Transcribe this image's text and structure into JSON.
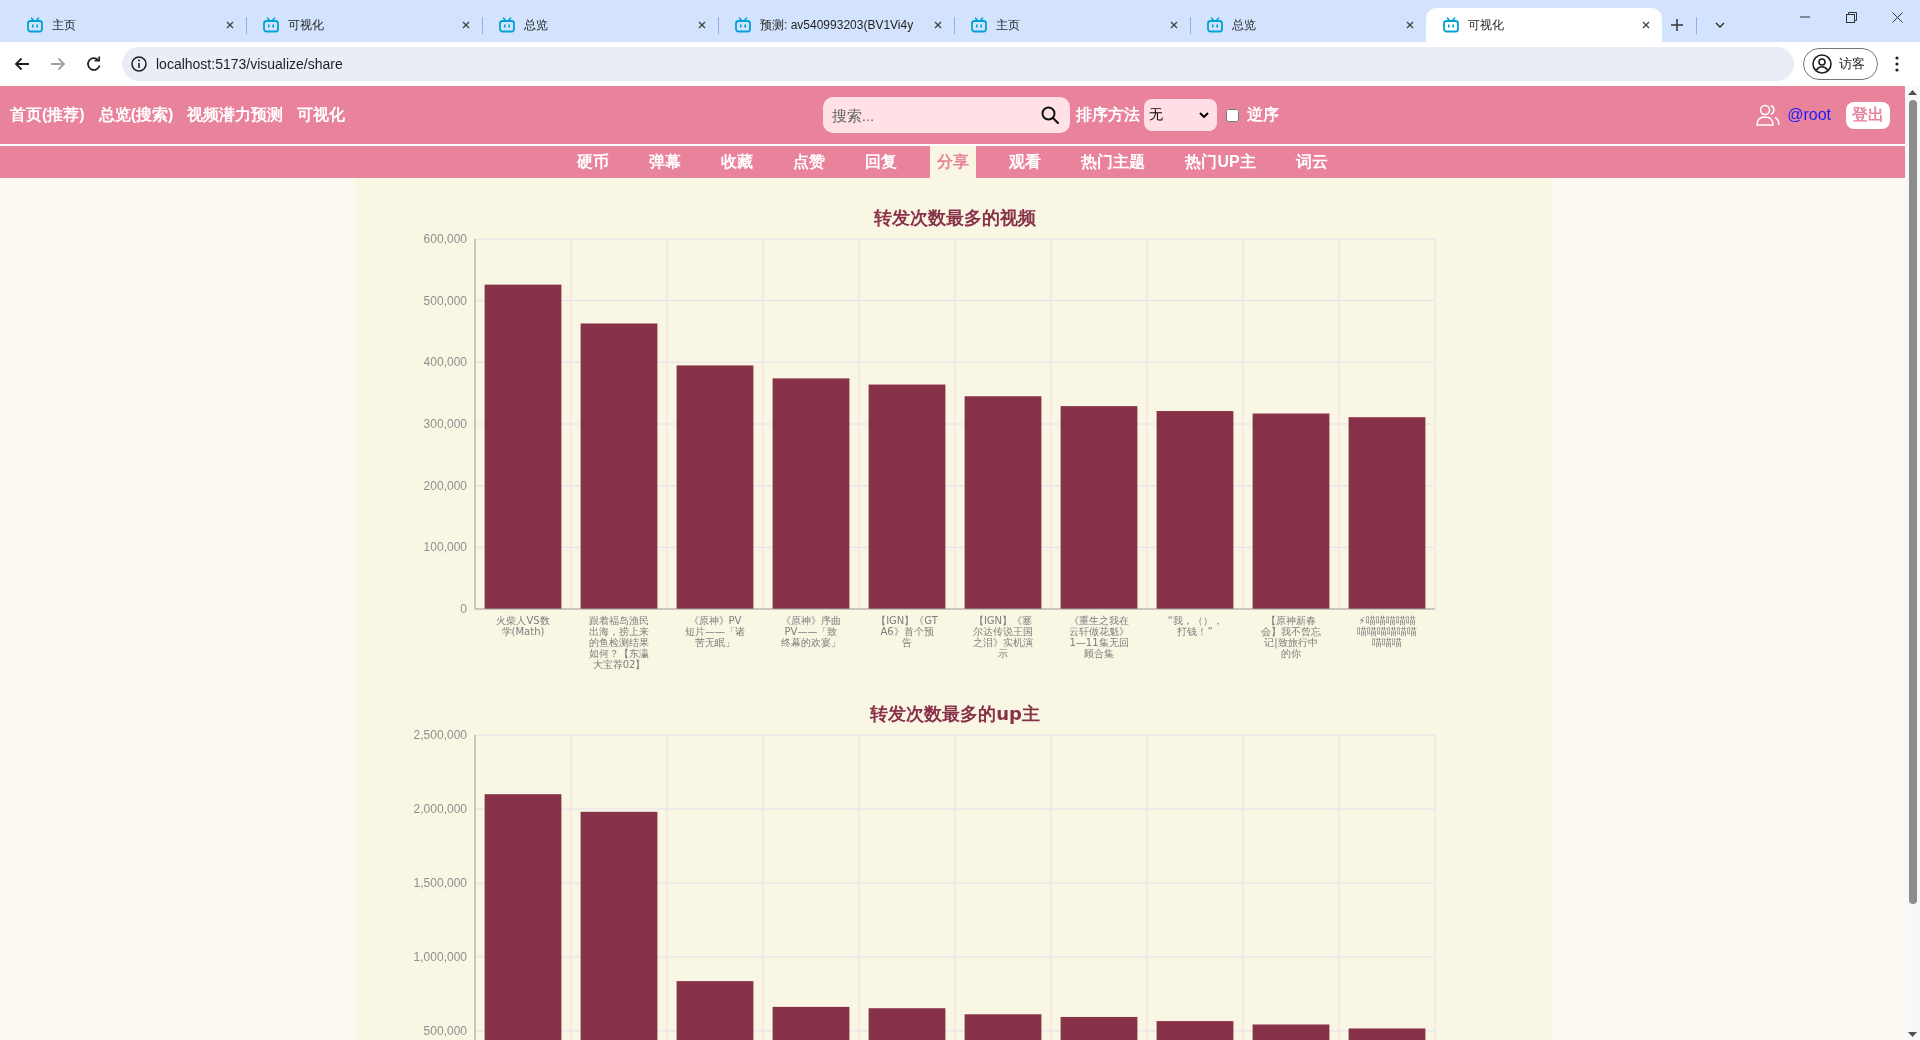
{
  "browser": {
    "tabs": [
      {
        "title": "主页",
        "selected": false
      },
      {
        "title": "可视化",
        "selected": false
      },
      {
        "title": "总览",
        "selected": false
      },
      {
        "title": "预测: av540993203(BV1Vi4y",
        "selected": false
      },
      {
        "title": "主页",
        "selected": false
      },
      {
        "title": "总览",
        "selected": false
      },
      {
        "title": "可视化",
        "selected": true
      }
    ],
    "url": "localhost:5173/visualize/share",
    "profile": "访客"
  },
  "header": {
    "nav": [
      "首页(推荐)",
      "总览(搜索)",
      "视频潜力预测",
      "可视化"
    ],
    "search": {
      "placeholder": "搜索..."
    },
    "sort": {
      "label": "排序方法",
      "value": "无"
    },
    "reverse": {
      "label": "逆序",
      "checked": false
    },
    "user": "@root",
    "logout": "登出"
  },
  "subnav": [
    {
      "label": "硬币",
      "selected": false
    },
    {
      "label": "弹幕",
      "selected": false
    },
    {
      "label": "收藏",
      "selected": false
    },
    {
      "label": "点赞",
      "selected": false
    },
    {
      "label": "回复",
      "selected": false
    },
    {
      "label": "分享",
      "selected": true
    },
    {
      "label": "观看",
      "selected": false
    },
    {
      "label": "热门主题",
      "selected": false
    },
    {
      "label": "热门UP主",
      "selected": false
    },
    {
      "label": "词云",
      "selected": false
    }
  ],
  "charts": [
    {
      "chart_data": {
        "type": "bar",
        "title": "转发次数最多的视频",
        "categories": [
          "火柴人VS数学(Math)",
          "跟着福岛渔民出海，捞上来的鱼检测结果如何？【东瀛大宝荐02】",
          "《原神》PV短片——「诸苦无眠」",
          "《原神》序曲PV——「致终幕的欢宴」",
          "【IGN】《GTA6》首个预告",
          "【IGN】《塞尔达传说王国之泪》实机演示",
          "《重生之我在云轩做花魁》1—11集无回顾合集",
          "“我，（），打钱！”",
          "【原神新春会】我不曾忘记|致旅行中的你",
          "⚡喵喵喵喵喵喵喵喵喵喵喵喵喵喵"
        ],
        "series": [
          {
            "color": "#883249",
            "values": [
              526000,
              463000,
              395000,
              374000,
              364000,
              345000,
              329000,
              321000,
              317000,
              311000
            ]
          }
        ],
        "ylim": [
          0,
          600000
        ],
        "yticks": [
          0,
          {
            "value": 100000,
            "label": "100,000"
          },
          {
            "value": 200000,
            "label": "200,000"
          },
          {
            "value": 300000,
            "label": "300,000"
          },
          {
            "value": 400000,
            "label": "400,000"
          },
          {
            "value": 500000,
            "label": "500,000"
          },
          {
            "value": 600000,
            "label": "600,000"
          }
        ],
        "grid": true
      }
    },
    {
      "chart_data": {
        "type": "bar",
        "title": "转发次数最多的up主",
        "series": [
          {
            "color": "#883249",
            "values": [
              2100000,
              1981000,
              837000,
              663000,
              654000,
              613000,
              595000,
              567000,
              544000,
              517000
            ]
          }
        ],
        "ylim": [
          0,
          2500000
        ],
        "yticks": [
          {
            "value": 500000,
            "label": "500,000"
          },
          {
            "value": 1000000,
            "label": "1,000,000"
          },
          {
            "value": 1500000,
            "label": "1,500,000"
          },
          {
            "value": 2000000,
            "label": "2,000,000"
          },
          {
            "value": 2500000,
            "label": "2,500,000"
          }
        ],
        "grid": true
      }
    }
  ]
}
